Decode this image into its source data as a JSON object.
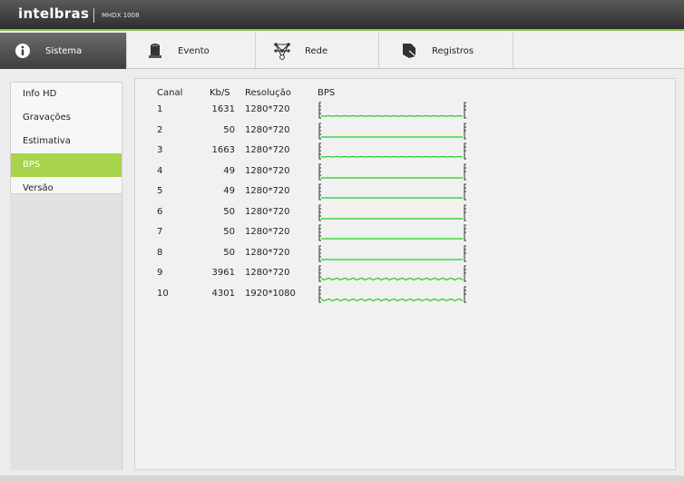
{
  "brand": {
    "logo": "intelbras",
    "model": "MHDX 1008"
  },
  "tabs": [
    {
      "label": "Sistema",
      "icon": "info-icon",
      "active": true
    },
    {
      "label": "Evento",
      "icon": "alarm-icon",
      "active": false
    },
    {
      "label": "Rede",
      "icon": "network-icon",
      "active": false
    },
    {
      "label": "Registros",
      "icon": "records-icon",
      "active": false
    }
  ],
  "sidebar": {
    "items": [
      {
        "label": "Info HD",
        "active": false
      },
      {
        "label": "Gravações",
        "active": false
      },
      {
        "label": "Estimativa",
        "active": false
      },
      {
        "label": "BPS",
        "active": true
      },
      {
        "label": "Versão",
        "active": false
      }
    ]
  },
  "table": {
    "headers": {
      "canal": "Canal",
      "kbs": "Kb/S",
      "resolucao": "Resolução",
      "bps": "BPS"
    },
    "rows": [
      {
        "canal": "1",
        "kbs": "1631",
        "resolucao": "1280*720"
      },
      {
        "canal": "2",
        "kbs": "50",
        "resolucao": "1280*720"
      },
      {
        "canal": "3",
        "kbs": "1663",
        "resolucao": "1280*720"
      },
      {
        "canal": "4",
        "kbs": "49",
        "resolucao": "1280*720"
      },
      {
        "canal": "5",
        "kbs": "49",
        "resolucao": "1280*720"
      },
      {
        "canal": "6",
        "kbs": "50",
        "resolucao": "1280*720"
      },
      {
        "canal": "7",
        "kbs": "50",
        "resolucao": "1280*720"
      },
      {
        "canal": "8",
        "kbs": "50",
        "resolucao": "1280*720"
      },
      {
        "canal": "9",
        "kbs": "3961",
        "resolucao": "1280*720"
      },
      {
        "canal": "10",
        "kbs": "4301",
        "resolucao": "1920*1080"
      }
    ]
  },
  "colors": {
    "accent": "#a8d34a",
    "graph_line": "#19d219",
    "brand_bar": "#3a3a3a"
  }
}
